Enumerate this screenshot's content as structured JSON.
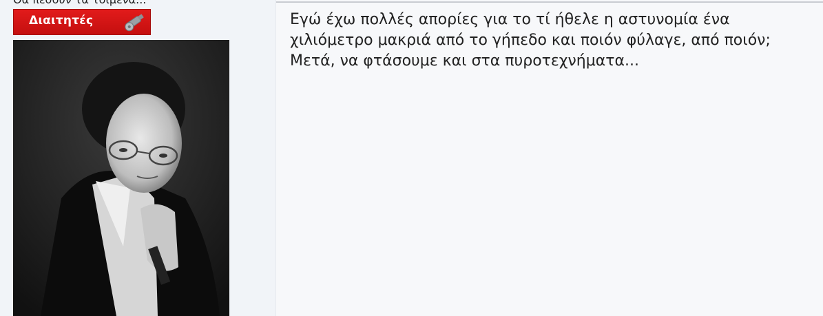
{
  "user": {
    "title": "Θα πέσουν τα τοιμενα...",
    "rank": {
      "label": "Διαιτητές",
      "icon": "whistle-icon",
      "color": "#d41414"
    },
    "avatar": {
      "icon": "avatar"
    }
  },
  "post": {
    "body": "Εγώ έχω πολλές απορίες για το τί ήθελε η αστυνομία ένα χιλιόμετρο μακριά από το γήπεδο και ποιόν φύλαγε, από ποιόν; Μετά, να φτάσουμε και στα πυροτεχνήματα..."
  }
}
